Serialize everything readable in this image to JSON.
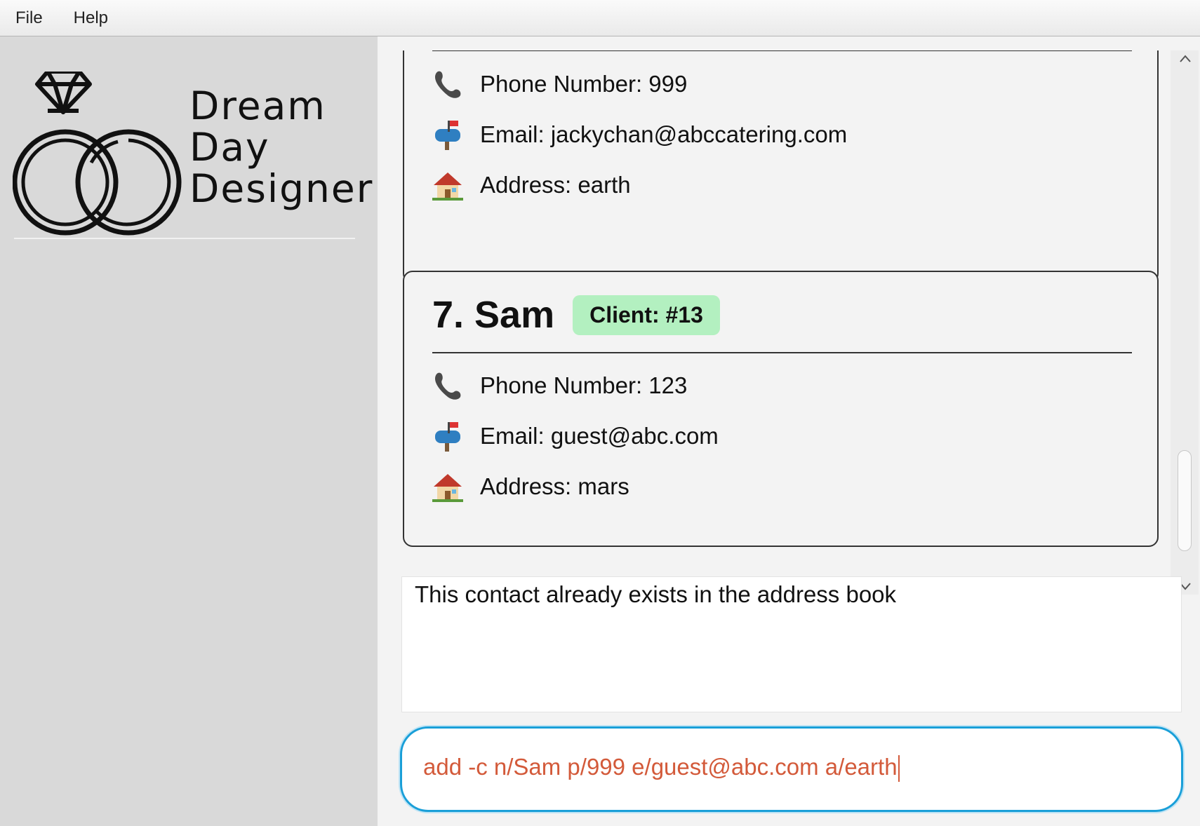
{
  "menubar": {
    "items": [
      {
        "label": "File"
      },
      {
        "label": "Help"
      }
    ]
  },
  "logo": {
    "lines": [
      "Dream",
      "Day",
      "Designer"
    ],
    "icon": "wedding-rings-icon"
  },
  "cards": [
    {
      "fields": [
        {
          "icon": "phone-icon",
          "text": "Phone Number: 999"
        },
        {
          "icon": "mailbox-icon",
          "text": "Email: jackychan@abccatering.com"
        },
        {
          "icon": "house-icon",
          "text": "Address: earth"
        }
      ]
    },
    {
      "name": "7. Sam",
      "tag": "Client: #13",
      "tag_color": "#b3f0c0",
      "fields": [
        {
          "icon": "phone-icon",
          "text": "Phone Number: 123"
        },
        {
          "icon": "mailbox-icon",
          "text": "Email: guest@abc.com"
        },
        {
          "icon": "house-icon",
          "text": "Address: mars"
        }
      ]
    }
  ],
  "result_display": {
    "text": "This contact already exists in the address book"
  },
  "command_box": {
    "value": "add -c n/Sam p/999 e/guest@abc.com a/earth",
    "text_color": "#d35a3a",
    "border_color": "#1a9fd8"
  }
}
